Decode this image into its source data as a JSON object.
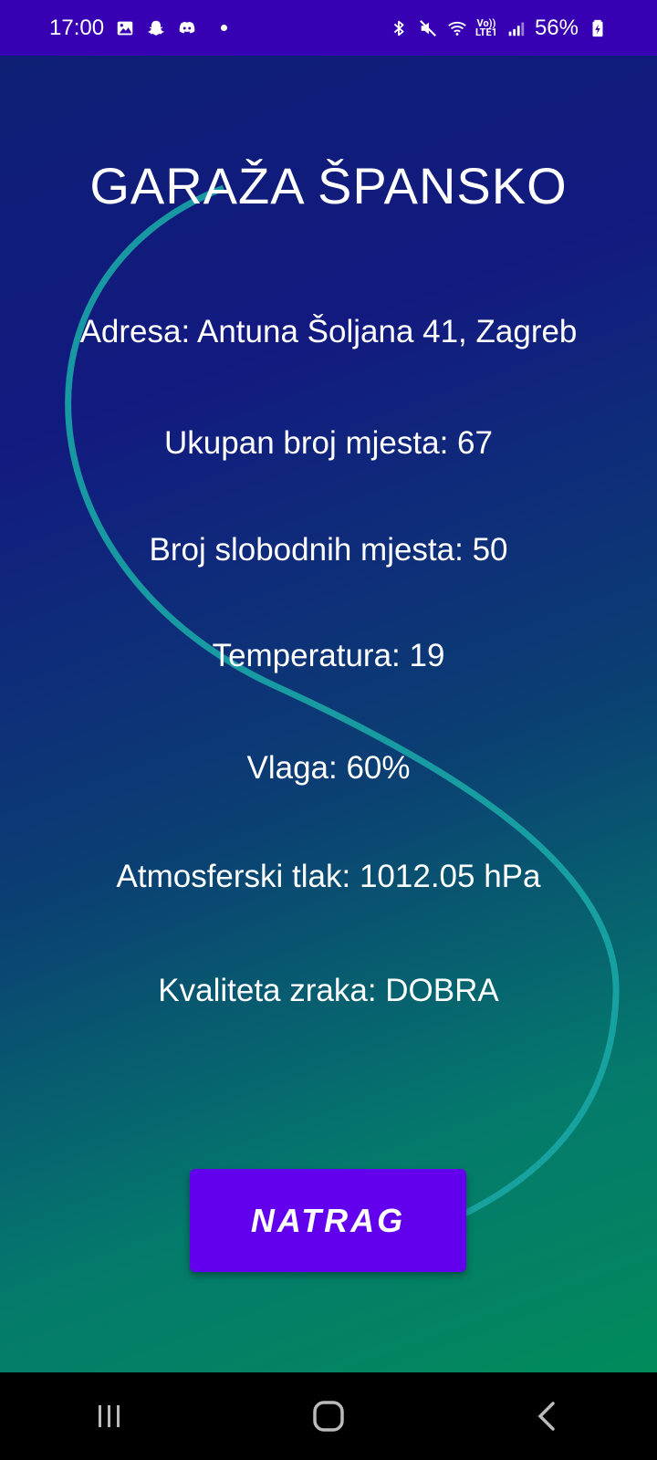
{
  "status_bar": {
    "time": "17:00",
    "battery": "56%",
    "lte_label": "Vo)) LTE1",
    "left_icons": [
      "gallery-icon",
      "snapchat-icon",
      "discord-icon",
      "notification-dot"
    ],
    "right_icons": [
      "bluetooth-icon",
      "mute-icon",
      "wifi-icon",
      "lte-icon",
      "signal-icon",
      "battery-icon"
    ]
  },
  "screen": {
    "title": "GARAŽA ŠPANSKO",
    "address": "Adresa: Antuna Šoljana 41, Zagreb",
    "total_spots": "Ukupan broj mjesta: 67",
    "free_spots": "Broj slobodnih mjesta: 50",
    "temperature": "Temperatura: 19",
    "humidity": "Vlaga: 60%",
    "pressure": "Atmosferski tlak: 1012.05 hPa",
    "air_quality": "Kvaliteta zraka: DOBRA",
    "back_button": "NATRAG"
  },
  "colors": {
    "status_bar": "#3700B3",
    "button": "#6200EE",
    "gradient_top": "#0e1f75",
    "gradient_bottom": "#028a5b",
    "wave": "#1aa6a6"
  },
  "nav_bar": {
    "icons": [
      "recent-apps-icon",
      "home-icon",
      "back-icon"
    ]
  }
}
